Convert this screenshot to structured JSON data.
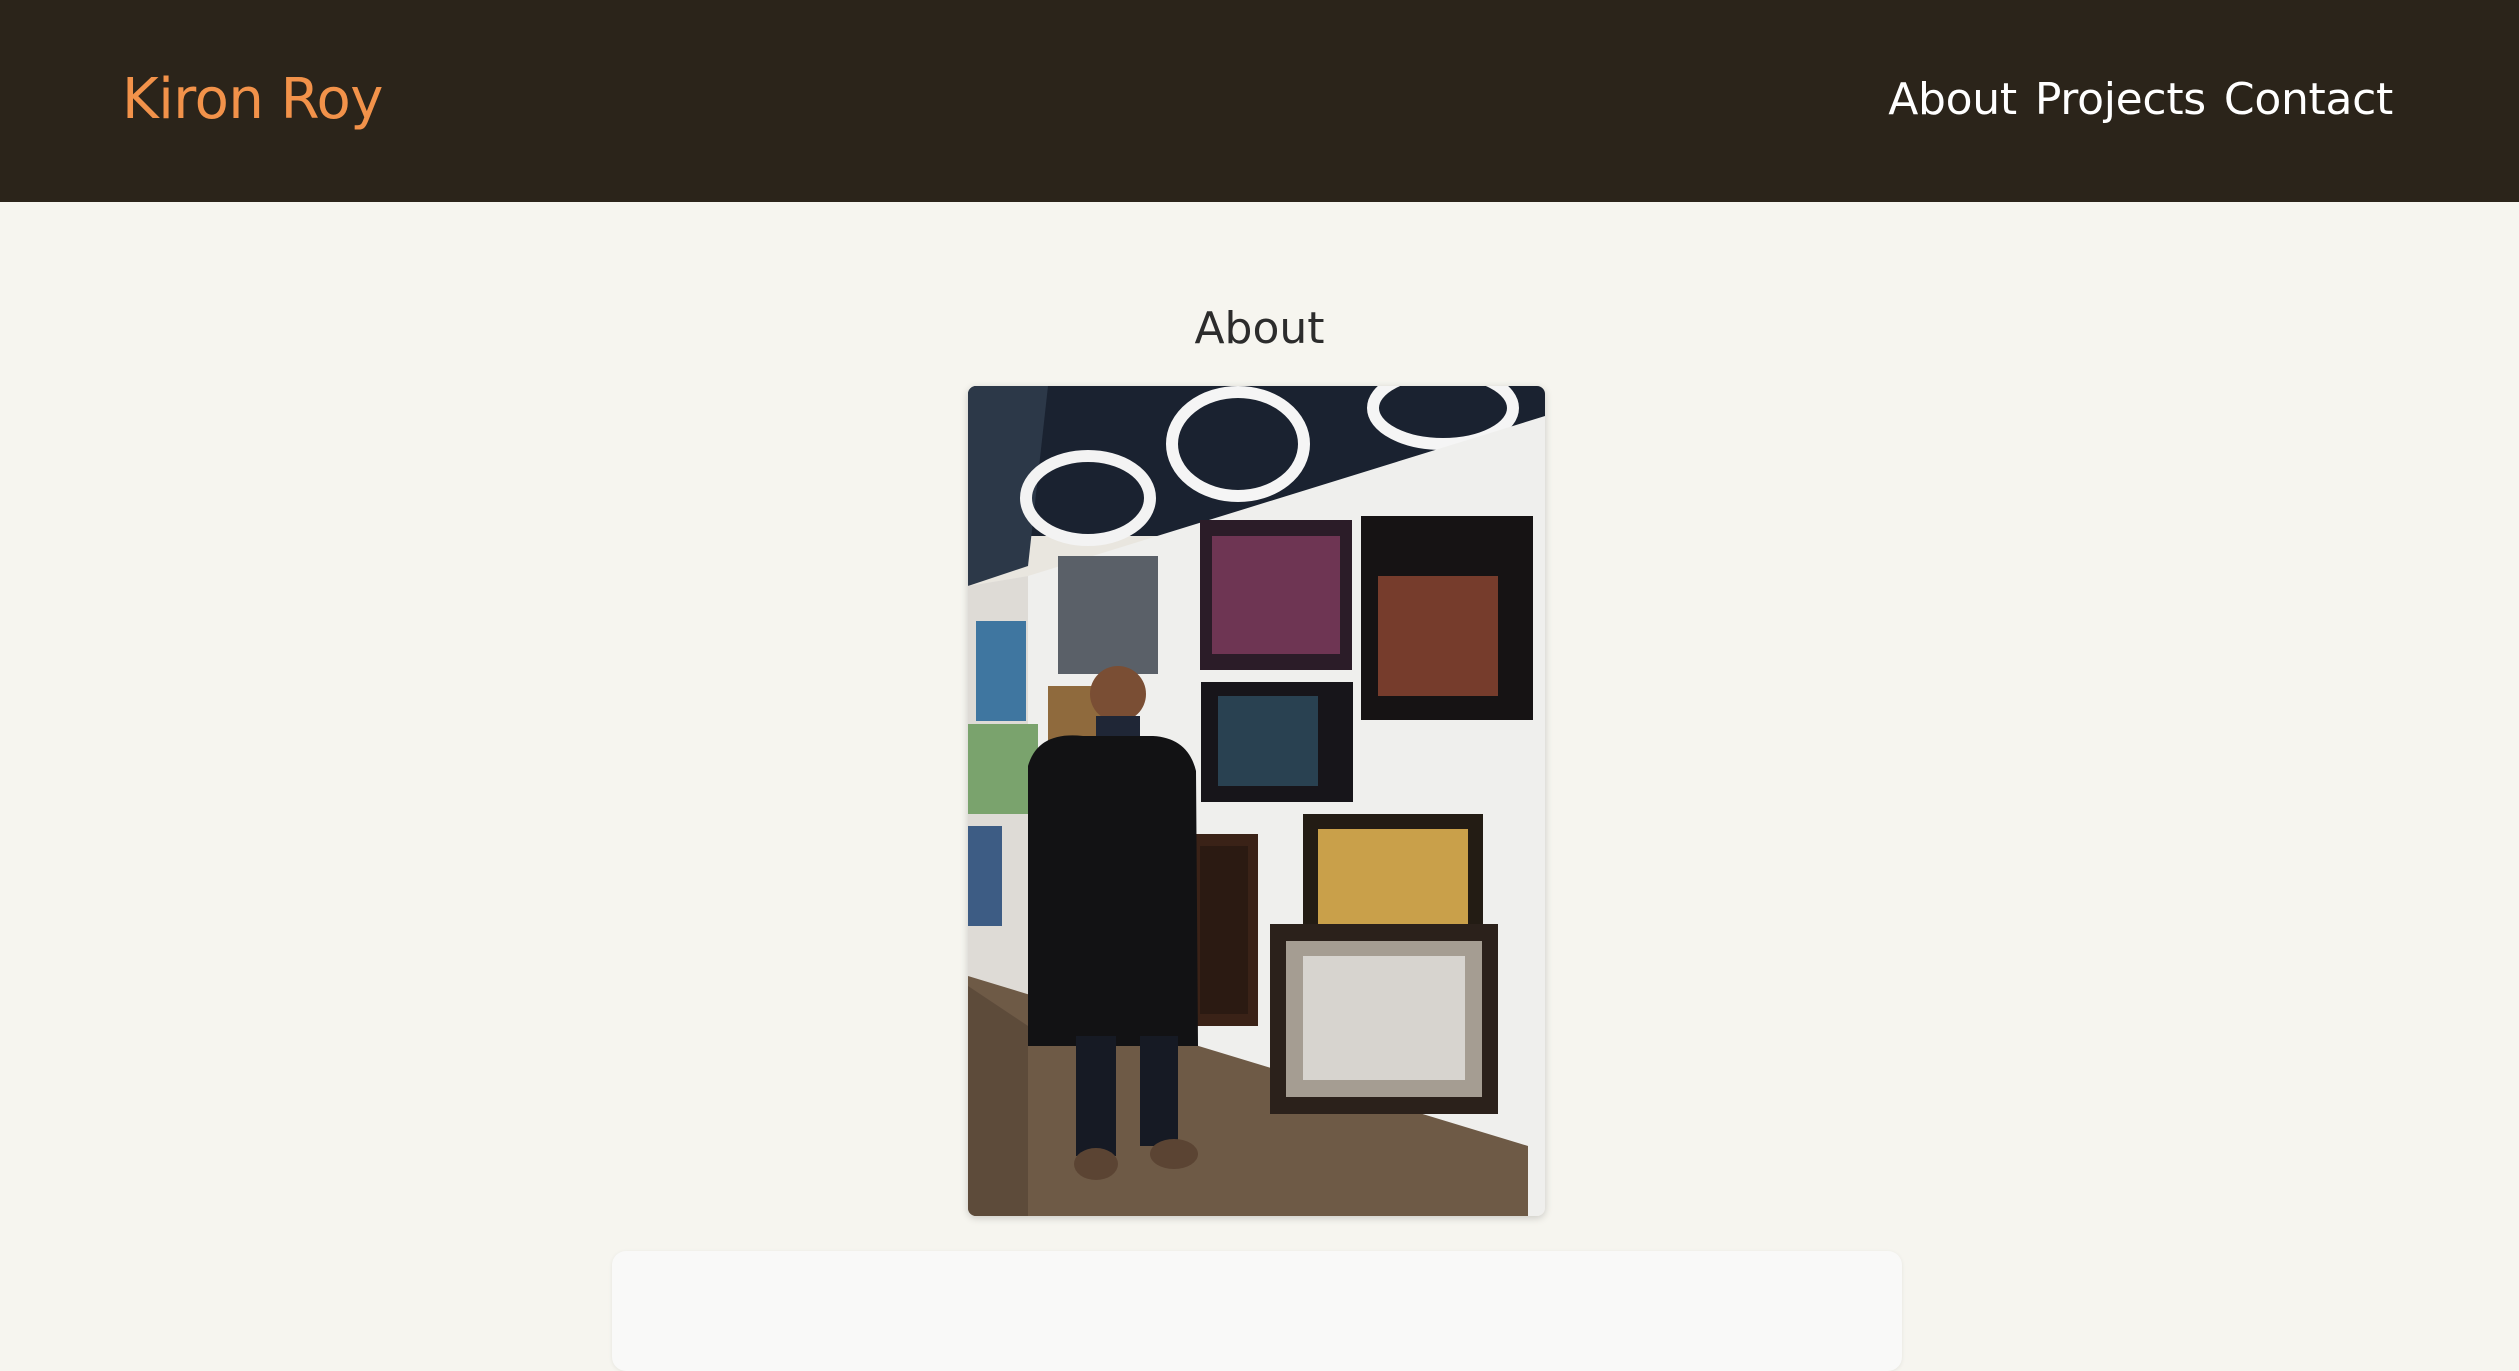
{
  "header": {
    "brand": "Kiron Roy",
    "nav": [
      "About",
      "Projects",
      "Contact"
    ]
  },
  "main": {
    "title": "About",
    "image_label": "exhibition-photo"
  },
  "colors": {
    "header_bg": "#2b241a",
    "brand": "#f2924a",
    "page_bg": "#f6f5ef"
  }
}
